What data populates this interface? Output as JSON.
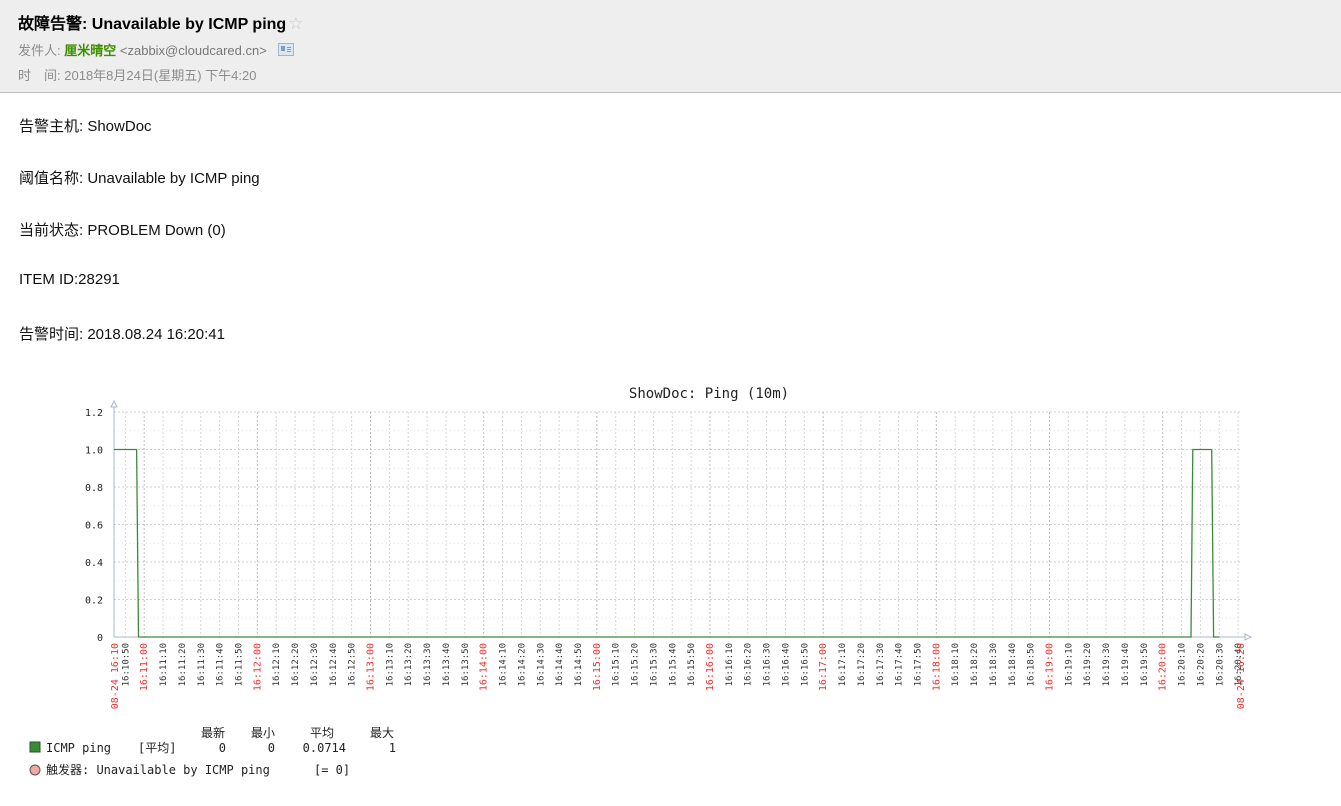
{
  "email": {
    "subject": "故障告警: Unavailable by ICMP ping",
    "from_label": "发件人:",
    "sender_name": "厘米晴空",
    "sender_email": "<zabbix@cloudcared.cn>",
    "time_label": "时　间:",
    "time_value": "2018年8月24日(星期五) 下午4:20",
    "star_icon": "star-icon",
    "contact_icon": "contact-card-icon"
  },
  "body": {
    "host": "告警主机: ShowDoc",
    "trigger": "阈值名称: Unavailable by ICMP ping",
    "status": "当前状态: PROBLEM Down (0)",
    "item_id": "ITEM ID:28291",
    "alert_time": "告警时间: 2018.08.24 16:20:41"
  },
  "chart_data": {
    "type": "line",
    "title": "ShowDoc: Ping (10m)",
    "ylim": [
      0,
      1.2
    ],
    "yticks": [
      "1.2",
      "1.0",
      "0.8",
      "0.6",
      "0.4",
      "0.2",
      "0"
    ],
    "grid": true,
    "x_start_label": "08-24 16:10",
    "x_end_label": "08-24 16:20",
    "xticks": [
      "16:10:50",
      "16:11:00",
      "16:11:10",
      "16:11:20",
      "16:11:30",
      "16:11:40",
      "16:11:50",
      "16:12:00",
      "16:12:10",
      "16:12:20",
      "16:12:30",
      "16:12:40",
      "16:12:50",
      "16:13:00",
      "16:13:10",
      "16:13:20",
      "16:13:30",
      "16:13:40",
      "16:13:50",
      "16:14:00",
      "16:14:10",
      "16:14:20",
      "16:14:30",
      "16:14:40",
      "16:14:50",
      "16:15:00",
      "16:15:10",
      "16:15:20",
      "16:15:30",
      "16:15:40",
      "16:15:50",
      "16:16:00",
      "16:16:10",
      "16:16:20",
      "16:16:30",
      "16:16:40",
      "16:16:50",
      "16:17:00",
      "16:17:10",
      "16:17:20",
      "16:17:30",
      "16:17:40",
      "16:17:50",
      "16:18:00",
      "16:18:10",
      "16:18:20",
      "16:18:30",
      "16:18:40",
      "16:18:50",
      "16:19:00",
      "16:19:10",
      "16:19:20",
      "16:19:30",
      "16:19:40",
      "16:19:50",
      "16:20:00",
      "16:20:10",
      "16:20:20",
      "16:20:30",
      "16:20:40"
    ],
    "series": [
      {
        "name": "ICMP ping",
        "color": "#3a8a3a",
        "x": [
          "16:10:44",
          "16:10:56",
          "16:10:57",
          "16:20:15",
          "16:20:16",
          "16:20:26",
          "16:20:27",
          "16:20:30"
        ],
        "values": [
          1,
          1,
          0,
          0,
          1,
          1,
          0,
          0
        ]
      }
    ],
    "legend": {
      "headers": [
        "最新",
        "最小",
        "平均",
        "最大"
      ],
      "item_name": "ICMP ping",
      "item_func": "[平均]",
      "item_values": [
        "0",
        "0",
        "0.0714",
        "1"
      ],
      "trigger_text": "触发器: Unavailable by ICMP ping",
      "trigger_cond": "[= 0]",
      "trigger_color": "#f0a8a0"
    }
  }
}
